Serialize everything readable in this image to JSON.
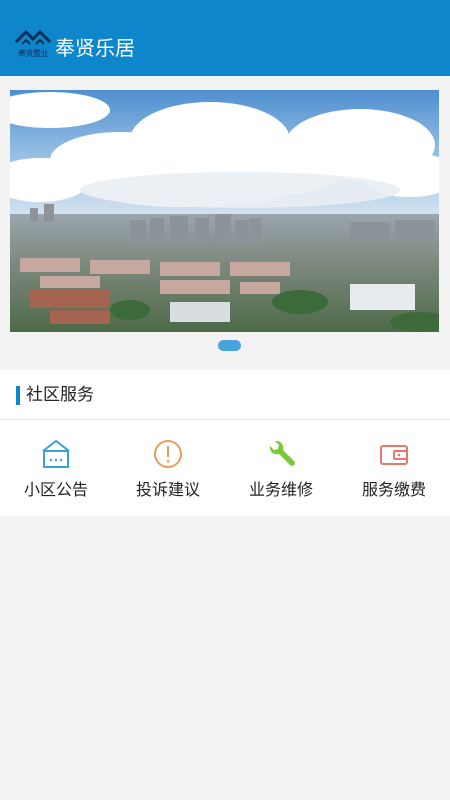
{
  "header": {
    "logo_text": "奉贤置业",
    "title": "奉贤乐居"
  },
  "banner": {
    "image": "city-aerial-photo",
    "slides": 1,
    "active_index": 0
  },
  "service": {
    "title": "社区服务",
    "items": [
      {
        "label": "小区公告",
        "icon": "house-notice-icon",
        "color": "#3aa0d8"
      },
      {
        "label": "投诉建议",
        "icon": "exclamation-circle-icon",
        "color": "#e0a060"
      },
      {
        "label": "业务维修",
        "icon": "wrench-icon",
        "color": "#7cc83c"
      },
      {
        "label": "服务缴费",
        "icon": "wallet-icon",
        "color": "#e07a6e"
      }
    ]
  },
  "colors": {
    "header_bg": "#0e86cc",
    "accent": "#0e86cc",
    "page_bg": "#f3f3f3"
  }
}
